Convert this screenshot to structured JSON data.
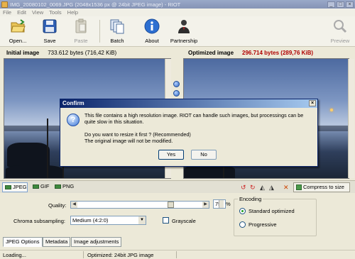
{
  "window": {
    "title": "IMG_20080102_0069.JPG (2048x1536 px @ 24bit JPEG image) - RIOT"
  },
  "menu": [
    "File",
    "Edit",
    "View",
    "Tools",
    "Help"
  ],
  "toolbar": {
    "open": "Open...",
    "save": "Save",
    "paste": "Paste",
    "batch": "Batch",
    "about": "About",
    "partnership": "Partnership",
    "preview": "Preview"
  },
  "initial": {
    "label": "Initial image",
    "size": "733.612 bytes (716,42 KiB)"
  },
  "optimized": {
    "label": "Optimized image",
    "size": "296.714 bytes (289,76 KiB)"
  },
  "dialog": {
    "title": "Confirm",
    "line1": "This file contains a high resolution image. RIOT can handle such images, but processings can be quite slow in this situation.",
    "line2": "Do you want to resize it first ? (Recommended)",
    "line3": "The original image will not be modified.",
    "yes": "Yes",
    "no": "No"
  },
  "formats": [
    "JPEG",
    "GIF",
    "PNG"
  ],
  "compress_label": "Compress to size",
  "options": {
    "quality_label": "Quality:",
    "quality_value": "75",
    "quality_unit": "%",
    "chroma_label": "Chroma subsampling:",
    "chroma_value": "Medium (4:2:0)",
    "grayscale_label": "Grayscale",
    "encoding_title": "Encoding",
    "encoding_standard": "Standard optimized",
    "encoding_progressive": "Progressive"
  },
  "bottom_tabs": [
    "JPEG Options",
    "Metadata",
    "Image adjustments"
  ],
  "status": {
    "left": "Loading...",
    "right": "Optimized: 24bit JPG image"
  },
  "colors": {
    "optimized_size": "#b00000",
    "dialog_title": "#0a246a"
  }
}
